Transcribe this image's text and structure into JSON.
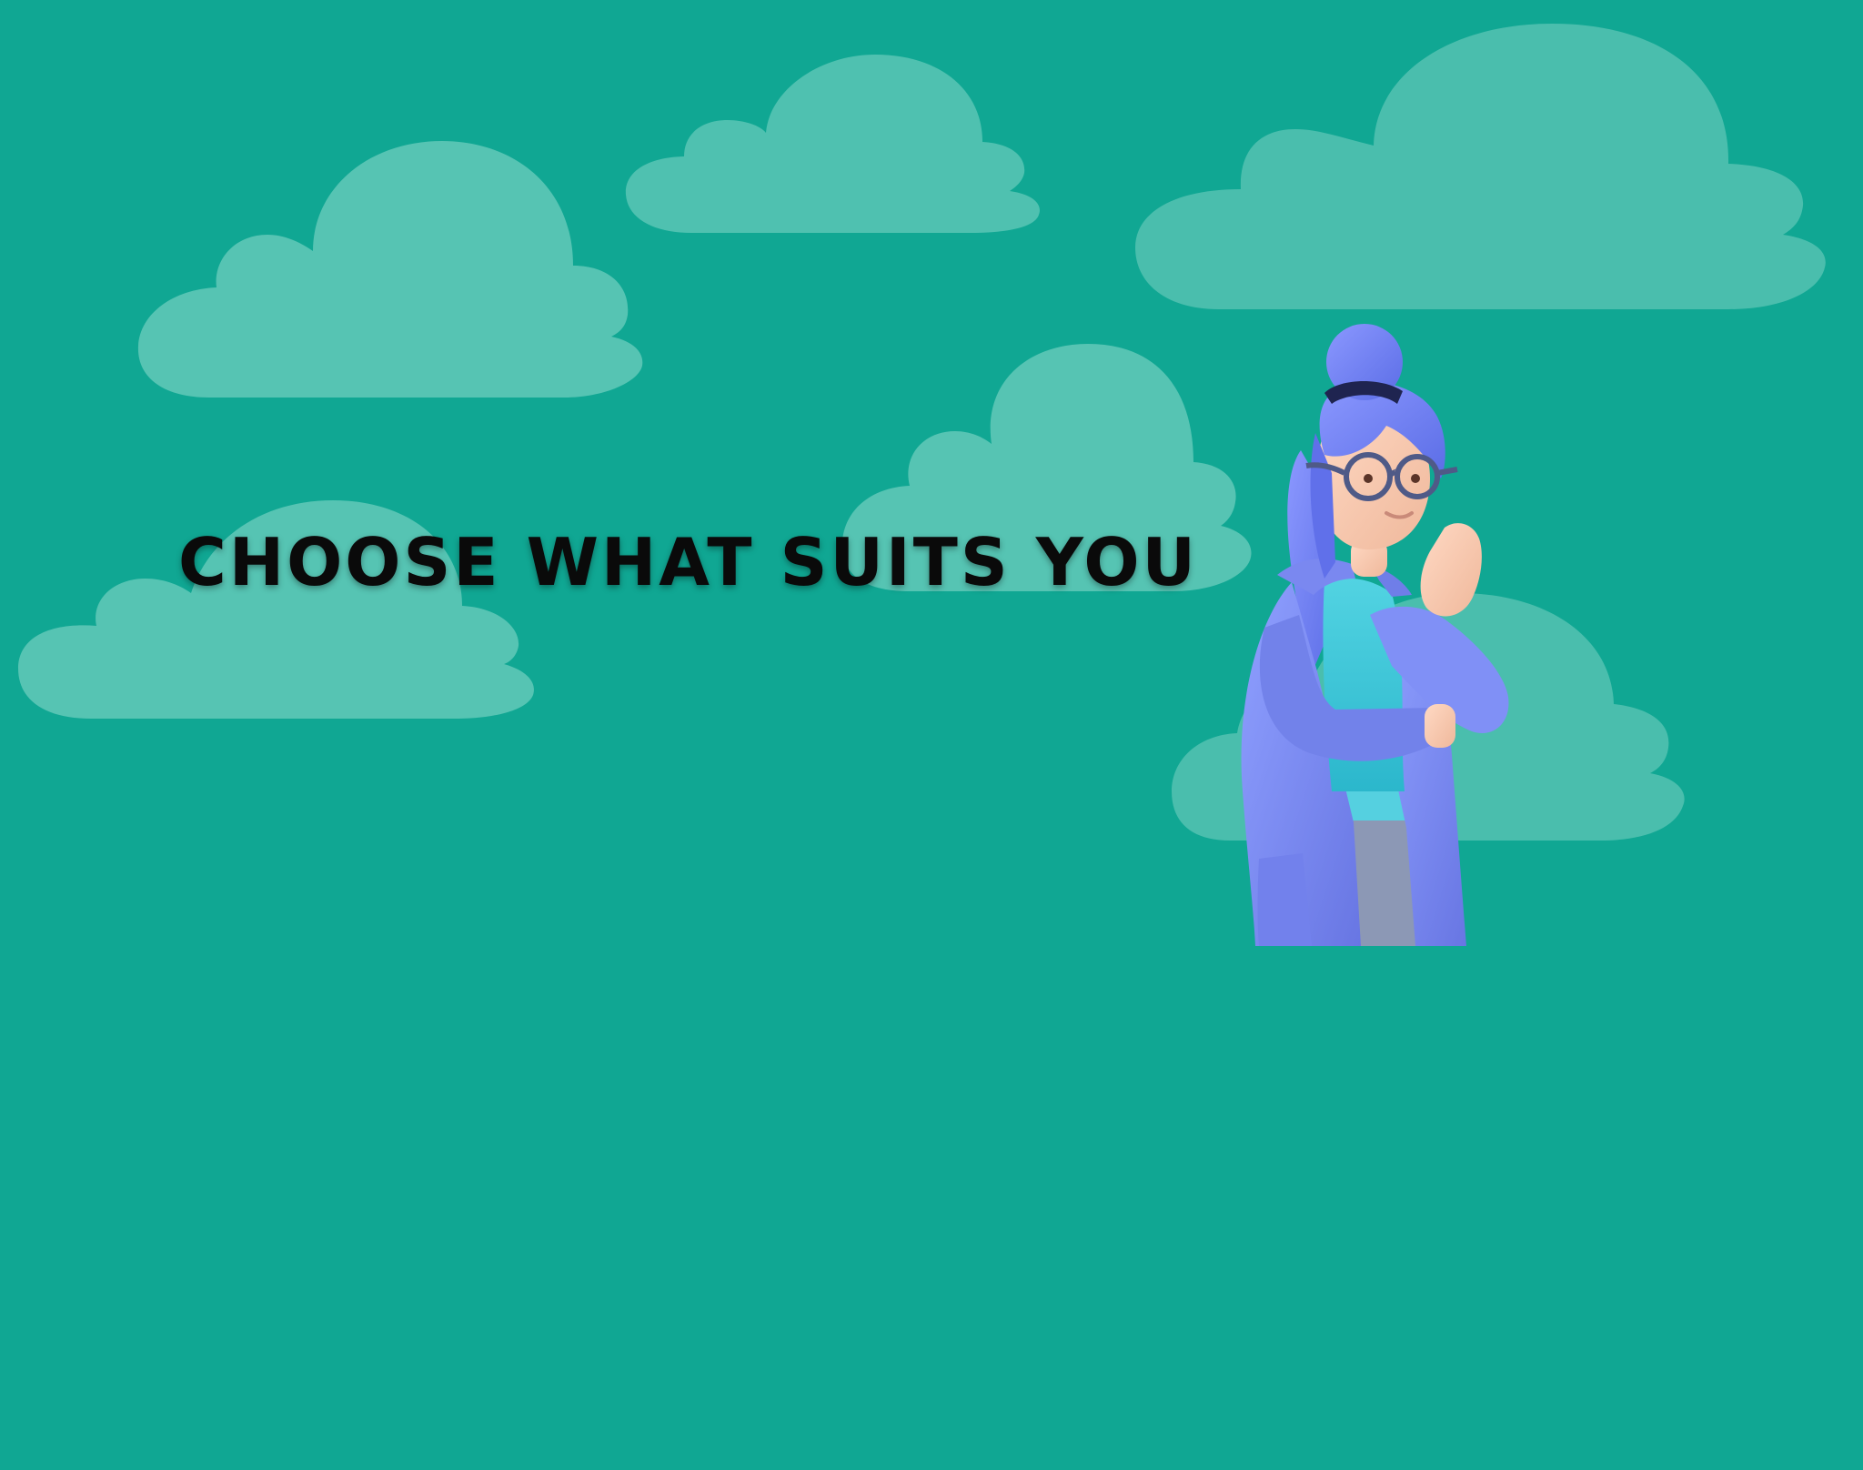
{
  "headline": "CHOOSE WHAT SUITS YOU",
  "colors": {
    "background": "#10a793",
    "cloud": "#b7ece0",
    "headline_text": "#0a0a0a",
    "coat": "#7b8cf0",
    "hair": "#6f80f0",
    "shirt": "#43c7d6",
    "skin": "#f6c9b0"
  },
  "icons": [
    "cloud",
    "thinking-woman-illustration"
  ]
}
